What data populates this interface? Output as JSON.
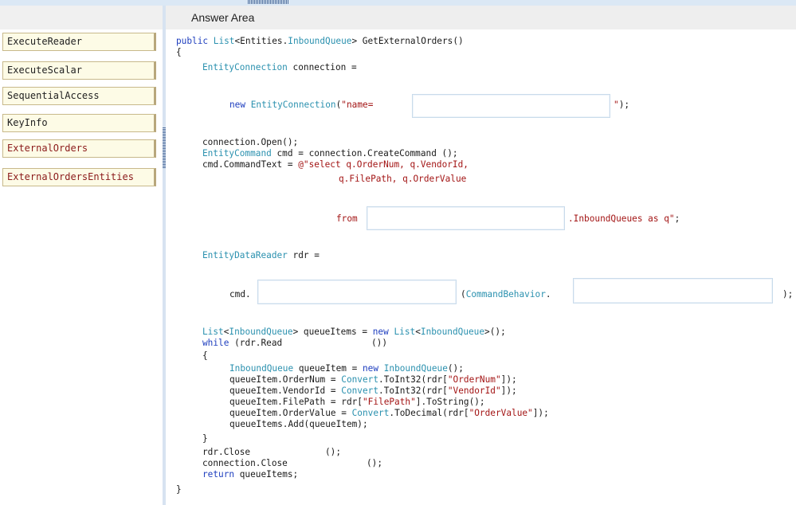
{
  "answer_area": {
    "title": "Answer Area"
  },
  "choices": [
    {
      "label": "ExecuteReader"
    },
    {
      "label": "ExecuteScalar"
    },
    {
      "label": "SequentialAccess"
    },
    {
      "label": "KeyInfo"
    },
    {
      "label": "ExternalOrders"
    },
    {
      "label": "ExternalOrdersEntities"
    }
  ],
  "code": {
    "method_sig": {
      "kw1": "public",
      "ty1": "List",
      "p1": "<Entities.",
      "ty2": "InboundQueue",
      "p2": "> GetExternalOrders()"
    },
    "brace_open": "{",
    "conn_decl": {
      "ty": "EntityConnection",
      "rest": " connection ="
    },
    "new_conn": {
      "kw": "new",
      "ty": "EntityConnection",
      "p1": "(",
      "st1": "\"name=",
      "st2": "\"",
      "p2": ");"
    },
    "open_line": "connection.Open();",
    "cmd_decl": {
      "ty": "EntityCommand",
      "rest": " cmd = connection.CreateCommand ();"
    },
    "cmdtext_line": {
      "pre": "cmd.CommandText = ",
      "st": "@\"select q.OrderNum, q.VendorId,"
    },
    "cmdtext_line2": "q.FilePath, q.OrderValue",
    "from_line": {
      "st1": "from",
      "st2": ".InboundQueues as q\"",
      "p": ";"
    },
    "reader_decl": {
      "ty": "EntityDataReader",
      "rest": " rdr ="
    },
    "exec_line": {
      "pre": "cmd.",
      "mid_open": "(",
      "ty": "CommandBehavior",
      "dot": ".",
      "close": ");"
    },
    "list_line": {
      "ty1": "List",
      "p1": "<",
      "ty2": "InboundQueue",
      "p2": "> queueItems = ",
      "kw": "new",
      "sp": " ",
      "ty3": "List",
      "p3": "<",
      "ty4": "InboundQueue",
      "p4": ">();"
    },
    "while_line": {
      "kw": "while",
      "rest": " (rdr.Read",
      "tail": "())"
    },
    "inner_open": "{",
    "item_decl": {
      "ty1": "InboundQueue",
      "p1": " queueItem = ",
      "kw": "new",
      "sp": " ",
      "ty2": "InboundQueue",
      "p2": "();"
    },
    "ordernum_line": {
      "pre": "queueItem.OrderNum = ",
      "ty": "Convert",
      "mid": ".ToInt32(rdr[",
      "st": "\"OrderNum\"",
      "post": "]);"
    },
    "vendorid_line": {
      "pre": "queueItem.VendorId = ",
      "ty": "Convert",
      "mid": ".ToInt32(rdr[",
      "st": "\"VendorId\"",
      "post": "]);"
    },
    "filepath_line": {
      "pre": "queueItem.FilePath = rdr[",
      "st": "\"FilePath\"",
      "post": "].ToString();"
    },
    "ordervalue_line": {
      "pre": "queueItem.OrderValue = ",
      "ty": "Convert",
      "mid": ".ToDecimal(rdr[",
      "st": "\"OrderValue\"",
      "post": "]);"
    },
    "add_line": "queueItems.Add(queueItem);",
    "inner_close": "}",
    "close_line": {
      "pre": "rdr.Close",
      "tail": "();"
    },
    "conn_close_line": {
      "pre": "connection.Close",
      "tail": "();"
    },
    "return_line": {
      "kw": "return",
      "rest": " queueItems;"
    },
    "brace_close": "}"
  }
}
